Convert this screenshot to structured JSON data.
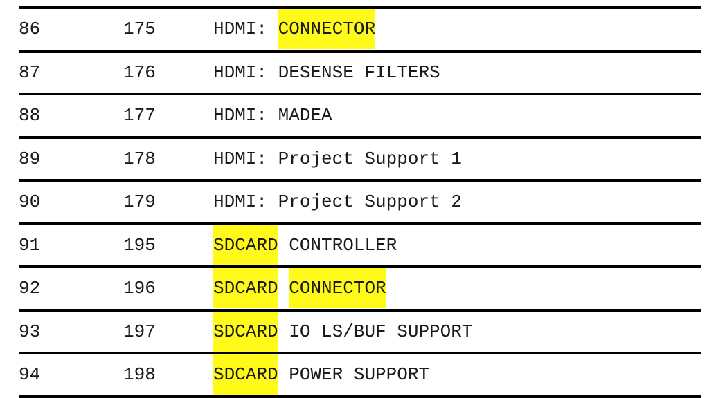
{
  "document": {
    "type": "table",
    "highlight_color": "#fffa1a",
    "text_color": "#1a1a1a",
    "rule_color": "#000000",
    "columns": [
      "index",
      "number",
      "description"
    ],
    "rows": [
      {
        "index": "86",
        "number": "175",
        "description": "HDMI: CONNECTOR",
        "segments": [
          {
            "text": "HDMI: ",
            "highlighted": false
          },
          {
            "text": "CONNECTOR",
            "highlighted": true
          }
        ]
      },
      {
        "index": "87",
        "number": "176",
        "description": "HDMI: DESENSE FILTERS",
        "segments": [
          {
            "text": "HDMI: DESENSE FILTERS",
            "highlighted": false
          }
        ]
      },
      {
        "index": "88",
        "number": "177",
        "description": "HDMI: MADEA",
        "segments": [
          {
            "text": "HDMI: MADEA",
            "highlighted": false
          }
        ]
      },
      {
        "index": "89",
        "number": "178",
        "description": "HDMI: Project Support 1",
        "segments": [
          {
            "text": "HDMI: Project Support 1",
            "highlighted": false
          }
        ]
      },
      {
        "index": "90",
        "number": "179",
        "description": "HDMI: Project Support 2",
        "segments": [
          {
            "text": "HDMI: Project Support 2",
            "highlighted": false
          }
        ]
      },
      {
        "index": "91",
        "number": "195",
        "description": "SDCARD CONTROLLER",
        "segments": [
          {
            "text": "SDCARD",
            "highlighted": true
          },
          {
            "text": " CONTROLLER",
            "highlighted": false
          }
        ]
      },
      {
        "index": "92",
        "number": "196",
        "description": "SDCARD CONNECTOR",
        "segments": [
          {
            "text": "SDCARD",
            "highlighted": true
          },
          {
            "text": " ",
            "highlighted": false
          },
          {
            "text": "CONNECTOR",
            "highlighted": true
          }
        ]
      },
      {
        "index": "93",
        "number": "197",
        "description": "SDCARD IO LS/BUF SUPPORT",
        "segments": [
          {
            "text": "SDCARD",
            "highlighted": true
          },
          {
            "text": " IO LS/BUF SUPPORT",
            "highlighted": false
          }
        ]
      },
      {
        "index": "94",
        "number": "198",
        "description": "SDCARD POWER SUPPORT",
        "segments": [
          {
            "text": "SDCARD",
            "highlighted": true
          },
          {
            "text": " POWER SUPPORT",
            "highlighted": false
          }
        ]
      }
    ]
  }
}
